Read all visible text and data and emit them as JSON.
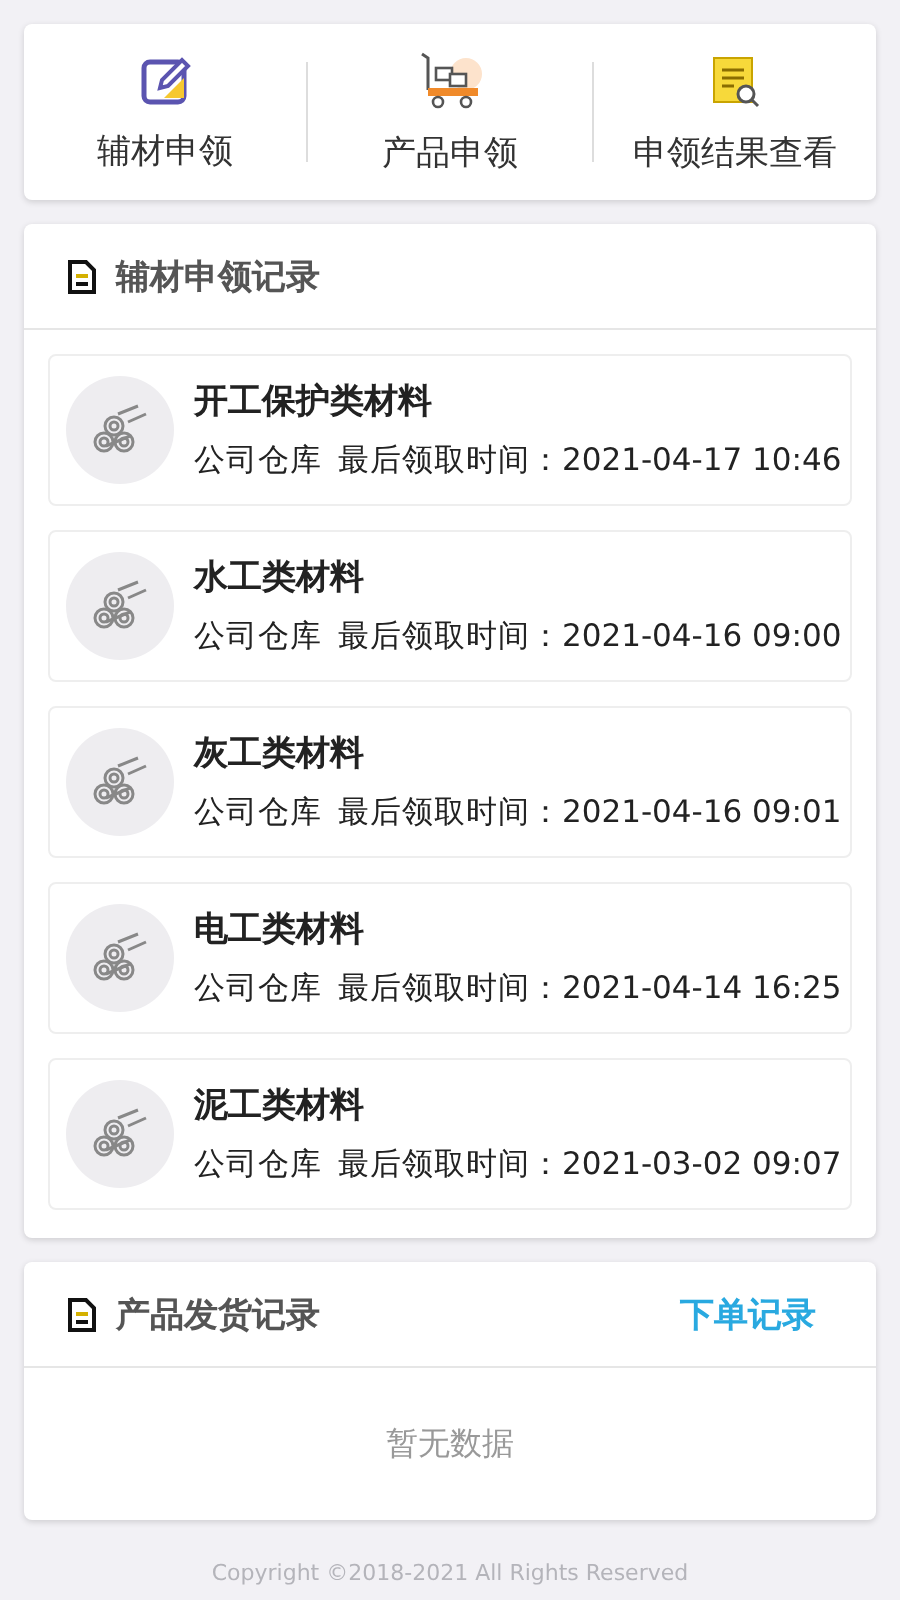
{
  "actions": [
    {
      "kind": "edit",
      "label": "辅材申领"
    },
    {
      "kind": "cart",
      "label": "产品申领"
    },
    {
      "kind": "report",
      "label": "申领结果查看"
    }
  ],
  "material_records": {
    "title": "辅材申领记录",
    "items": [
      {
        "name": "开工保护类材料",
        "warehouse": "公司仓库",
        "time": "最后领取时间：2021-04-17 10:46"
      },
      {
        "name": "水工类材料",
        "warehouse": "公司仓库",
        "time": "最后领取时间：2021-04-16 09:00"
      },
      {
        "name": "灰工类材料",
        "warehouse": "公司仓库",
        "time": "最后领取时间：2021-04-16 09:01"
      },
      {
        "name": "电工类材料",
        "warehouse": "公司仓库",
        "time": "最后领取时间：2021-04-14 16:25"
      },
      {
        "name": "泥工类材料",
        "warehouse": "公司仓库",
        "time": "最后领取时间：2021-03-02 09:07"
      }
    ]
  },
  "shipping_records": {
    "title": "产品发货记录",
    "link": "下单记录",
    "empty": "暂无数据"
  },
  "footer": "Copyright ©2018-2021 All Rights Reserved"
}
